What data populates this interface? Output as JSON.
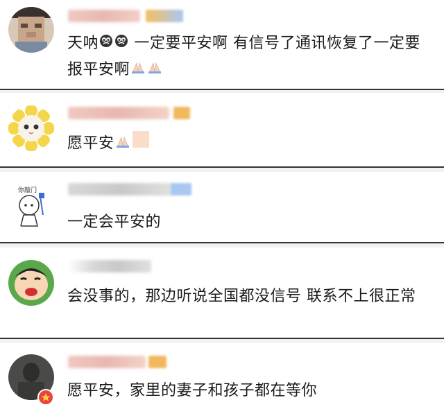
{
  "comments": [
    {
      "text_1": "天呐",
      "text_2": " 一定要平安啊 有信号了通讯恢复了一定要报平安啊",
      "avatar_icon": "pixelated-man-avatar",
      "emoji": [
        "crying-face-icon",
        "crying-face-icon",
        "praying-hands-icon",
        "praying-hands-icon"
      ]
    },
    {
      "text_1": "愿平安",
      "avatar_icon": "flower-cat-avatar",
      "emoji": [
        "praying-hands-icon",
        "peach-square-icon"
      ]
    },
    {
      "text_1": "一定会平安的",
      "avatar_icon": "cartoon-nurse-avatar",
      "avatar_text": "你敲门"
    },
    {
      "text_1": "会没事的，那边听说全国都没信号 联系不上很正常",
      "avatar_icon": "crayon-shinchan-avatar"
    },
    {
      "text_1": "愿平安，家里的妻子和孩子都在等你",
      "avatar_icon": "dark-photo-avatar"
    }
  ],
  "colors": {
    "separator": "#333333",
    "gap": "#f2f2f2",
    "text": "#1a1a1a",
    "blurred_name": "#e8b8a8",
    "blurred_badge": "#f2c060"
  }
}
